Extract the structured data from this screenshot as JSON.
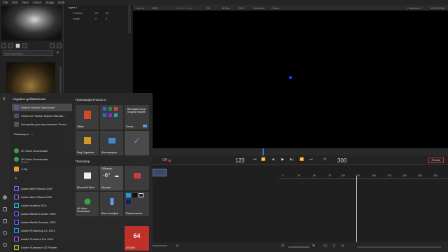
{
  "menubar": [
    "File",
    "Edit",
    "View",
    "Action",
    "Stage",
    "Help"
  ],
  "preset": {
    "search_placeholder": "Все эмиттеры..."
  },
  "props": {
    "layer": "Layer 1",
    "rows": [
      {
        "label": "Position",
        "v1": "60",
        "v2": "80"
      },
      {
        "label": "Angle",
        "v1": "0",
        "v2": "0"
      }
    ]
  },
  "viewer_bar": {
    "items": [
      "Сцена",
      "100%",
      "Render View",
      "2D",
      "M-Blur",
      "RGB",
      "Deflector",
      "Force"
    ],
    "particles": "Particles: 0",
    "resolution": "1920×1080"
  },
  "transport": {
    "current": "123",
    "end": "300",
    "off": "Off",
    "render": "Render"
  },
  "timeline_ticks": [
    "0",
    "25",
    "50",
    "75",
    "100",
    "125",
    "150",
    "175",
    "200",
    "225",
    "250"
  ],
  "bottom_bar": {
    "a": "0",
    "b": "2",
    "c": "9",
    "zoom": "62"
  },
  "start": {
    "recent_title": "Недавно добавленные",
    "recent": [
      "Particle Illusion Standalone",
      "Check for Particle Illusion Standal...",
      "Настройка для приложения \"Флэш..."
    ],
    "expand": "Развернуть",
    "apps": [
      {
        "name": "4K Video Downloader",
        "sub": ""
      },
      {
        "name": "4K Video Downloader",
        "sub": "Новые"
      },
      {
        "name": "7-Zip",
        "sub": ""
      },
      {
        "name": "A",
        "sub": ""
      },
      {
        "name": "Adobe After Effects 2019",
        "sub": ""
      },
      {
        "name": "Adobe After Effects 2022",
        "sub": ""
      },
      {
        "name": "Adobe Audition 2021",
        "sub": ""
      },
      {
        "name": "Adobe Media Encoder 2019",
        "sub": ""
      },
      {
        "name": "Adobe Media Encoder 2022",
        "sub": ""
      },
      {
        "name": "Adobe Photoshop CC 2019",
        "sub": ""
      },
      {
        "name": "Adobe Premiere Pro 2019",
        "sub": ""
      },
      {
        "name": "Adobe Substance 3D Painter",
        "sub": ""
      }
    ],
    "productivity": "Производительность",
    "tiles": {
      "office": "Office",
      "mail_text": "Все ваши почты в одной службе",
      "mail": "Почта",
      "regorg": "Reg Organizer",
      "photos": "Фотографии",
      "store": "Microsoft Store",
      "weather_top": "Облачно",
      "weather_temp": "-6°",
      "weather_city": "Москва",
      "video_dl": "4K Video Downloader",
      "phone": "Ваш телефон",
      "fun": "Развлечения",
      "aida": "AIDA64",
      "aida_num": "64"
    },
    "explore": "Просмотр"
  }
}
